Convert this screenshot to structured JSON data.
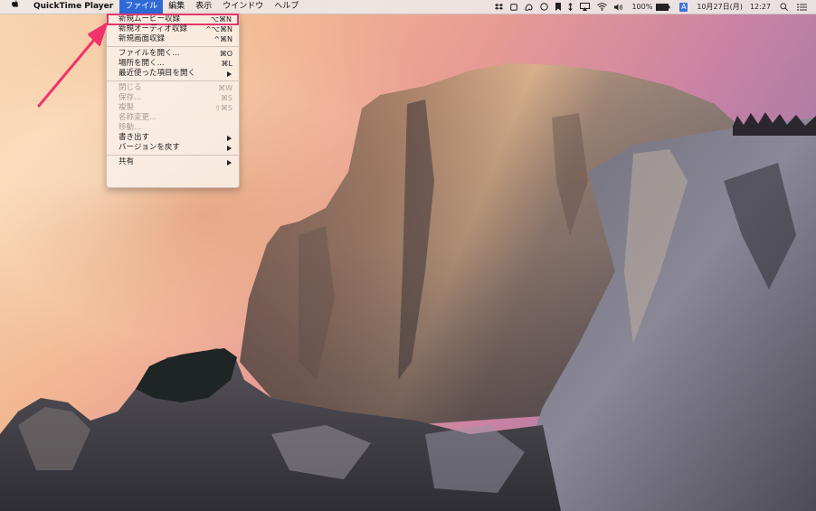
{
  "menubar": {
    "apple_icon": "apple-logo-icon",
    "app_name": "QuickTime Player",
    "menus": [
      {
        "label": "ファイル",
        "active": true
      },
      {
        "label": "編集"
      },
      {
        "label": "表示"
      },
      {
        "label": "ウインドウ"
      },
      {
        "label": "ヘルプ"
      }
    ],
    "status": {
      "icons": [
        "dropbox-icon",
        "square-icon",
        "evernote-icon",
        "circle-icon",
        "bookmark-icon",
        "sync-arrows-icon",
        "airplay-icon",
        "wifi-icon",
        "volume-icon"
      ],
      "battery_percent": "100%",
      "input_method": "A",
      "datetime": "10月27日(月)",
      "time": "12:27",
      "spotlight_icon": "search-icon",
      "notification_icon": "list-icon"
    }
  },
  "file_menu": {
    "items": [
      {
        "label": "新規ムービー収録",
        "shortcut": "⌥⌘N",
        "enabled": true,
        "highlighted": true
      },
      {
        "label": "新規オーディオ収録",
        "shortcut": "^⌥⌘N",
        "enabled": true
      },
      {
        "label": "新規画面収録",
        "shortcut": "^⌘N",
        "enabled": true
      },
      {
        "separator": true
      },
      {
        "label": "ファイルを開く...",
        "shortcut": "⌘O",
        "enabled": true
      },
      {
        "label": "場所を開く...",
        "shortcut": "⌘L",
        "enabled": true
      },
      {
        "label": "最近使った項目を開く",
        "submenu": true,
        "enabled": true
      },
      {
        "separator": true
      },
      {
        "label": "閉じる",
        "shortcut": "⌘W",
        "enabled": false
      },
      {
        "label": "保存...",
        "shortcut": "⌘S",
        "enabled": false
      },
      {
        "label": "複製",
        "shortcut": "⇧⌘S",
        "enabled": false
      },
      {
        "label": "名称変更...",
        "enabled": false
      },
      {
        "label": "移動...",
        "enabled": false
      },
      {
        "label": "書き出す",
        "submenu": true,
        "enabled": true
      },
      {
        "label": "バージョンを戻す",
        "submenu": true,
        "enabled": true
      },
      {
        "separator": true
      },
      {
        "label": "共有",
        "submenu": true,
        "enabled": true
      }
    ]
  },
  "annotation": {
    "type": "arrow",
    "color": "#f0336a",
    "points_to": "新規ムービー収録"
  },
  "colors": {
    "menu_highlight": "#2f6ad6",
    "annotation": "#f0336a"
  }
}
